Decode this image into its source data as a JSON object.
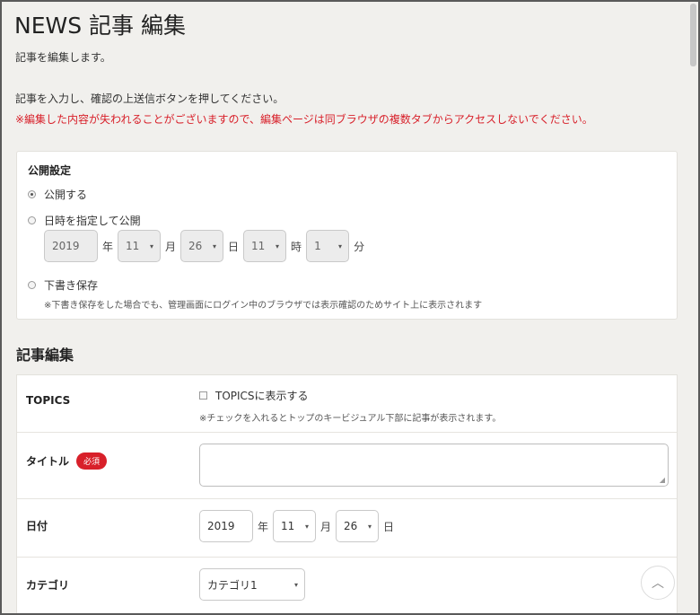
{
  "page": {
    "title": "NEWS 記事 編集",
    "intro": "記事を編集します。",
    "instruction": "記事を入力し、確認の上送信ボタンを押してください。",
    "warning": "※編集した内容が失われることがございますので、編集ページは同ブラウザの複数タブからアクセスしないでください。"
  },
  "publish": {
    "heading": "公開設定",
    "options": [
      "公開する",
      "日時を指定して公開",
      "下書き保存"
    ],
    "selected": "公開する",
    "datetime": {
      "year": "2019",
      "year_unit": "年",
      "month": "11",
      "month_unit": "月",
      "day": "26",
      "day_unit": "日",
      "hour": "11",
      "hour_unit": "時",
      "minute": "1",
      "minute_unit": "分"
    },
    "draft_note": "※下書き保存をした場合でも、管理画面にログイン中のブラウザでは表示確認のためサイト上に表示されます"
  },
  "edit": {
    "section_title": "記事編集",
    "topics": {
      "label": "TOPICS",
      "checkbox_label": "TOPICSに表示する",
      "checked": false,
      "note": "※チェックを入れるとトップのキービジュアル下部に記事が表示されます。"
    },
    "title_field": {
      "label": "タイトル",
      "required_badge": "必須",
      "value": ""
    },
    "date_field": {
      "label": "日付",
      "year": "2019",
      "year_unit": "年",
      "month": "11",
      "month_unit": "月",
      "day": "26",
      "day_unit": "日"
    },
    "category_field": {
      "label": "カテゴリ",
      "value": "カテゴリ1"
    }
  },
  "icons": {
    "dropdown": "▾",
    "scroll_top": "︿",
    "resize": "◢"
  },
  "colors": {
    "warning": "#d8202a",
    "required_badge": "#d8202a",
    "background": "#f1f0ed"
  }
}
